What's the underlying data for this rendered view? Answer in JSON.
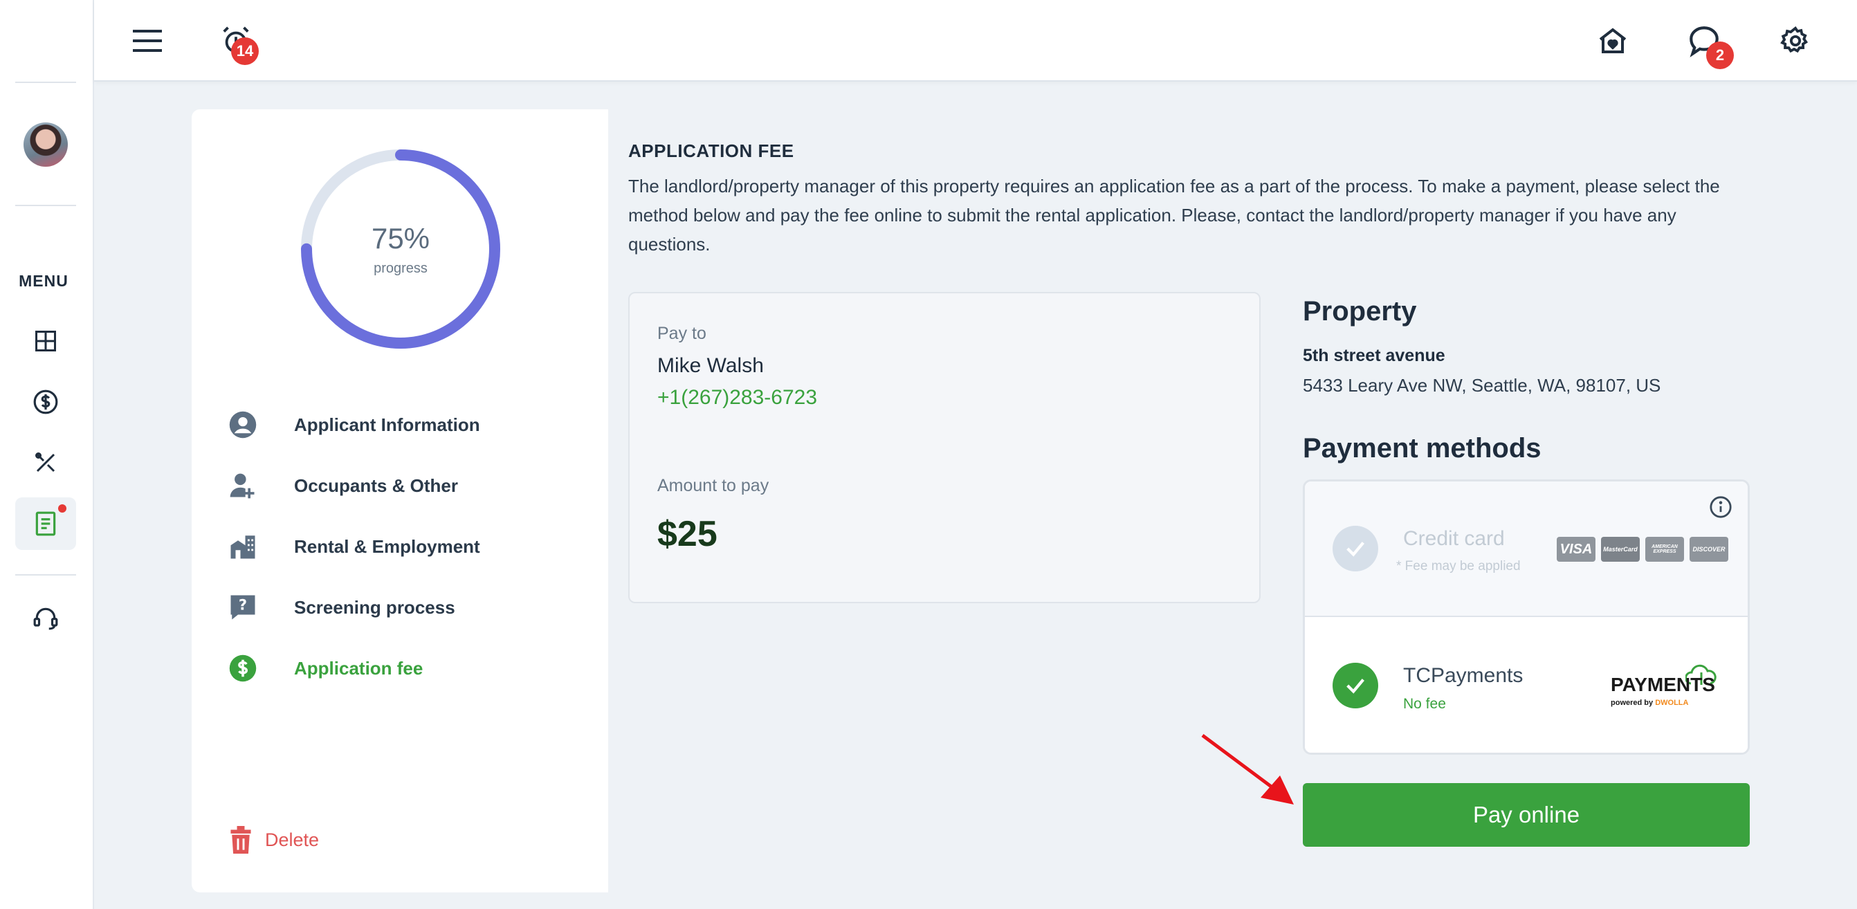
{
  "sidebar": {
    "menu_label": "MENU",
    "items": [
      {
        "icon": "dashboard-icon"
      },
      {
        "icon": "dollar-icon"
      },
      {
        "icon": "tools-icon"
      },
      {
        "icon": "document-icon",
        "active": true,
        "has_notification": true
      },
      {
        "icon": "headset-icon"
      }
    ]
  },
  "header": {
    "menu_icon": "hamburger-icon",
    "alerts_count": "14",
    "messages_count": "2"
  },
  "progress": {
    "percent_label": "75%",
    "percent_value": 0.75,
    "sub_label": "progress"
  },
  "steps": [
    {
      "label": "Applicant Information",
      "icon": "user-circle-icon"
    },
    {
      "label": "Occupants & Other",
      "icon": "user-plus-icon"
    },
    {
      "label": "Rental & Employment",
      "icon": "building-icon"
    },
    {
      "label": "Screening process",
      "icon": "question-chat-icon"
    },
    {
      "label": "Application fee",
      "icon": "dollar-circle-icon",
      "current": true
    }
  ],
  "delete_label": "Delete",
  "fee": {
    "title": "APPLICATION FEE",
    "description": "The landlord/property manager of this property requires an application fee as a part of the process. To make a payment, please select the method below and pay the fee online to submit the rental application. Please, contact the landlord/property manager if you have any questions."
  },
  "pay_card": {
    "pay_to_label": "Pay to",
    "name": "Mike Walsh",
    "phone": "+1(267)283-6723",
    "amount_label": "Amount to pay",
    "amount": "$25"
  },
  "property": {
    "title": "Property",
    "name": "5th street avenue",
    "address": "5433 Leary Ave NW, Seattle, WA, 98107, US"
  },
  "payment_methods": {
    "title": "Payment methods",
    "options": [
      {
        "name": "Credit card",
        "note": "* Fee may be applied",
        "enabled": false,
        "logos": [
          "VISA",
          "MasterCard",
          "AMERICAN EXPRESS",
          "DISCOVER"
        ]
      },
      {
        "name": "TCPayments",
        "note": "No fee",
        "enabled": true,
        "logo_text": "PAYMENTS",
        "logo_sub_prefix": "powered by",
        "logo_sub_brand": "DWOLLA"
      }
    ]
  },
  "pay_button": "Pay online",
  "colors": {
    "accent_green": "#3aa23e",
    "progress_ring": "#6b6fdc",
    "alert_red": "#e53935",
    "delete_red": "#e05555"
  }
}
